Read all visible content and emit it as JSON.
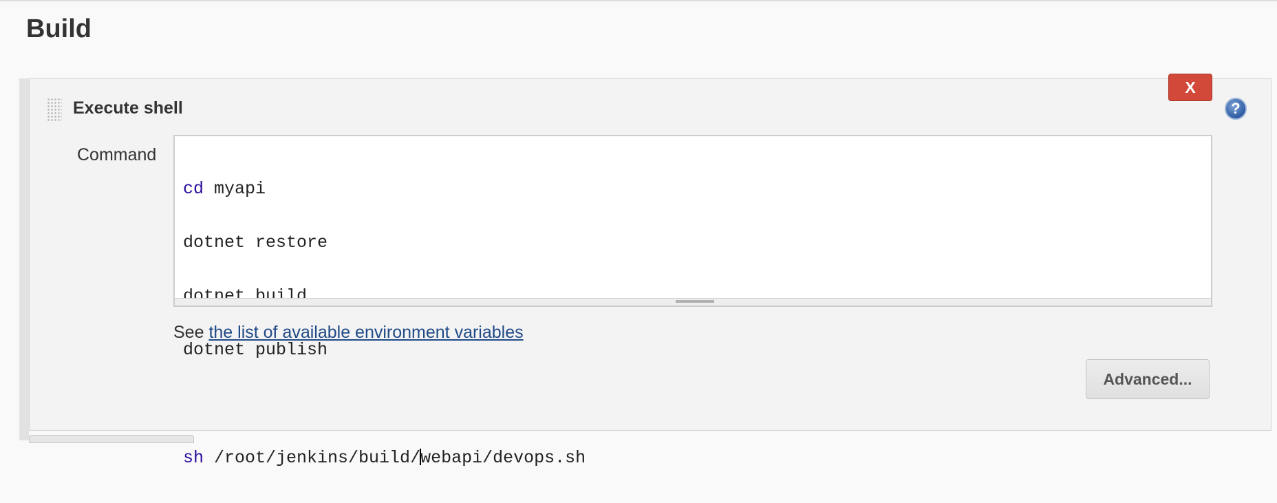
{
  "section": {
    "title": "Build"
  },
  "step": {
    "title": "Execute shell",
    "delete_label": "X",
    "help_label": "?",
    "command_label": "Command",
    "command_lines": [
      {
        "keyword": "cd",
        "rest": " myapi"
      },
      {
        "keyword": "",
        "rest": "dotnet restore"
      },
      {
        "keyword": "",
        "rest": "dotnet build"
      },
      {
        "keyword": "",
        "rest": "dotnet publish"
      },
      {
        "keyword": "",
        "rest": ""
      },
      {
        "keyword": "sh",
        "rest": " /root/jenkins/build/",
        "cursor_after": "webapi/devops.sh"
      }
    ],
    "env_help_prefix": "See ",
    "env_help_link": "the list of available environment variables",
    "advanced_label": "Advanced..."
  },
  "colors": {
    "keyword": "#2c0d9c",
    "link": "#204a87",
    "delete_button": "#d24939"
  }
}
